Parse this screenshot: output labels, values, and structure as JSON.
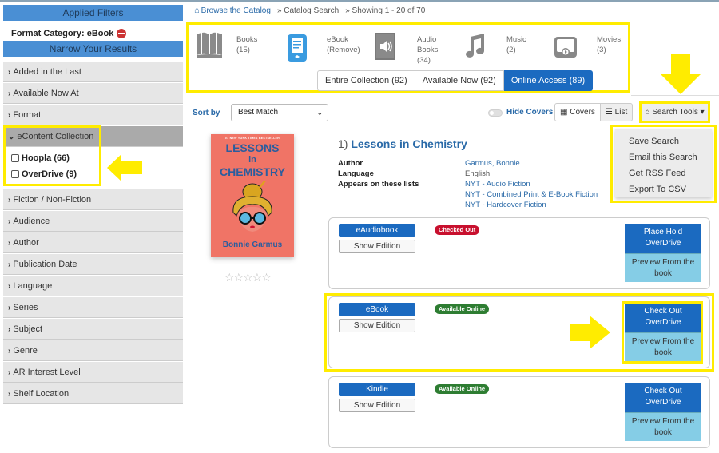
{
  "sidebar": {
    "applied_filters_header": "Applied Filters",
    "applied_filter": "Format Category: eBook",
    "narrow_header": "Narrow Your Results",
    "facets_before": [
      {
        "label": "Added in the Last"
      },
      {
        "label": "Available Now At"
      },
      {
        "label": "Format"
      }
    ],
    "open_facet": {
      "label": "eContent Collection",
      "options": [
        {
          "label": "Hoopla (66)",
          "checked": false
        },
        {
          "label": "OverDrive (9)",
          "checked": false
        }
      ]
    },
    "facets_after": [
      {
        "label": "Fiction / Non-Fiction"
      },
      {
        "label": "Audience"
      },
      {
        "label": "Author"
      },
      {
        "label": "Publication Date"
      },
      {
        "label": "Language"
      },
      {
        "label": "Series"
      },
      {
        "label": "Subject"
      },
      {
        "label": "Genre"
      },
      {
        "label": "AR Interest Level"
      },
      {
        "label": "Shelf Location"
      }
    ]
  },
  "breadcrumb": {
    "home": "Browse the Catalog",
    "search": "» Catalog Search",
    "showing": "» Showing 1 - 20 of 70"
  },
  "formats": [
    {
      "icon": "book-icon",
      "name": "Books",
      "detail": "(15)"
    },
    {
      "icon": "ebook-icon",
      "name": "eBook",
      "detail": "(Remove)"
    },
    {
      "icon": "audiobook-icon",
      "name": "Audio Books",
      "detail": "(34)"
    },
    {
      "icon": "music-icon",
      "name": "Music",
      "detail": "(2)"
    },
    {
      "icon": "movie-icon",
      "name": "Movies",
      "detail": "(3)"
    }
  ],
  "availability_tabs": [
    {
      "label": "Entire Collection (92)",
      "active": false
    },
    {
      "label": "Available Now (92)",
      "active": false
    },
    {
      "label": "Online Access (89)",
      "active": true
    }
  ],
  "toolbar": {
    "sort_label": "Sort by",
    "sort_value": "Best Match",
    "hide_covers": "Hide Covers",
    "covers": "Covers",
    "list": "List",
    "search_tools": "Search Tools"
  },
  "search_tools_menu": [
    "Save Search",
    "Email this Search",
    "Get RSS Feed",
    "Export To CSV"
  ],
  "result": {
    "number": "1)",
    "title": "Lessons in Chemistry",
    "cover": {
      "banner": "#1 NEW YORK TIMES BESTSELLER",
      "title_line1": "LESSONS",
      "title_line2": "in",
      "title_line3": "CHEMISTRY",
      "author": "Bonnie Garmus"
    },
    "rating_stars": 0,
    "details": [
      {
        "label": "Author",
        "values": [
          "Garmus, Bonnie"
        ],
        "link": true
      },
      {
        "label": "Language",
        "values": [
          "English"
        ],
        "link": false
      },
      {
        "label": "Appears on these lists",
        "values": [
          "NYT - Audio Fiction",
          "NYT - Combined Print & E-Book Fiction",
          "NYT - Hardcover Fiction"
        ],
        "link": true
      }
    ],
    "editions": [
      {
        "format": "eAudiobook",
        "show": "Show Edition",
        "status": "Checked Out",
        "status_type": "out",
        "primary_line1": "Place Hold",
        "primary_line2": "OverDrive",
        "secondary_line1": "Preview From the",
        "secondary_line2": "book"
      },
      {
        "format": "eBook",
        "show": "Show Edition",
        "status": "Available Online",
        "status_type": "avail",
        "primary_line1": "Check Out",
        "primary_line2": "OverDrive",
        "secondary_line1": "Preview From the",
        "secondary_line2": "book"
      },
      {
        "format": "Kindle",
        "show": "Show Edition",
        "status": "Available Online",
        "status_type": "avail",
        "primary_line1": "Check Out",
        "primary_line2": "OverDrive",
        "secondary_line1": "Preview From the",
        "secondary_line2": "book"
      }
    ]
  },
  "colors": {
    "highlight": "#ffec00",
    "primary": "#1b6ac0",
    "link": "#2a6aa8",
    "checked_out": "#c8102e",
    "available": "#2e7d32",
    "preview": "#85cde6"
  }
}
